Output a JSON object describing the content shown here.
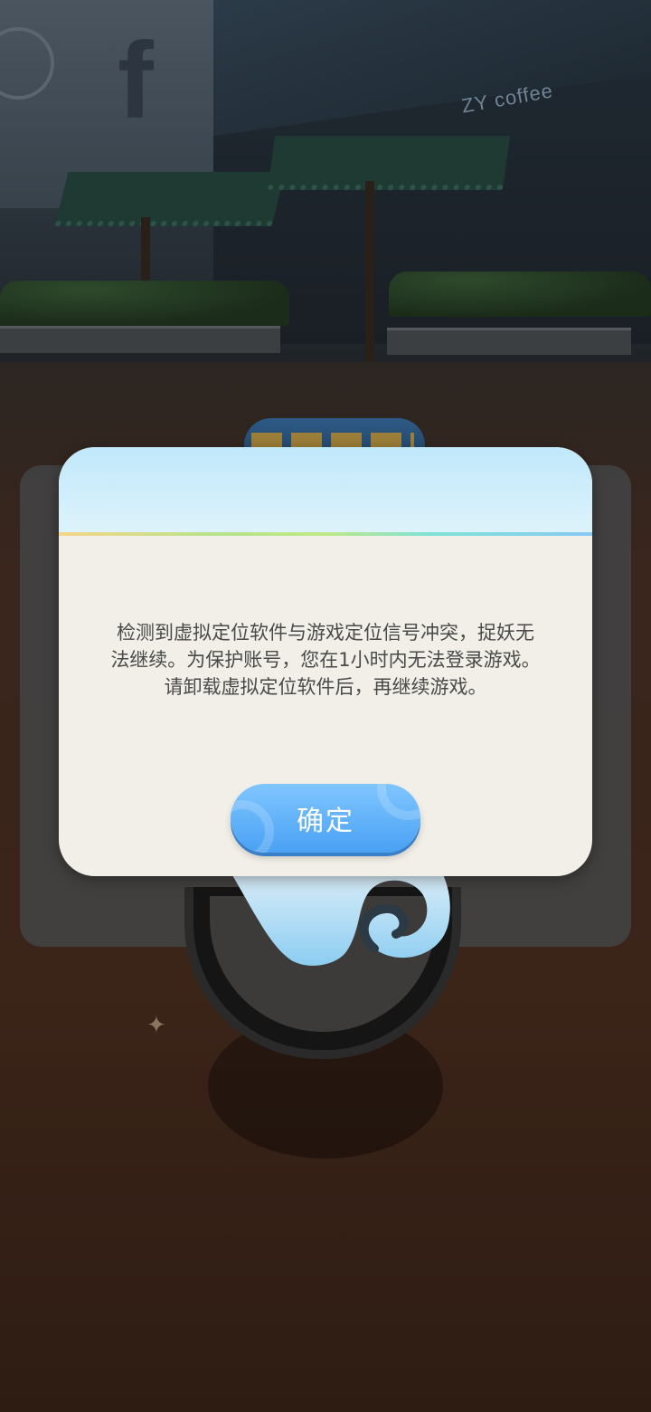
{
  "background": {
    "shop_sign": "ZY coffee"
  },
  "dialog": {
    "message_lines": [
      "检测到虚拟定位软件与游戏定位信号冲突，捉妖无",
      "法继续。为保护账号，您在1小时内无法登录游戏。",
      "请卸载虚拟定位软件后，再继续游戏。"
    ],
    "confirm_label": "确定"
  },
  "colors": {
    "dialog_bg": "#f1efe7",
    "header_blue": "#c0e8fb",
    "button_blue": "#4aa1f3",
    "text": "#4a4a4a"
  }
}
